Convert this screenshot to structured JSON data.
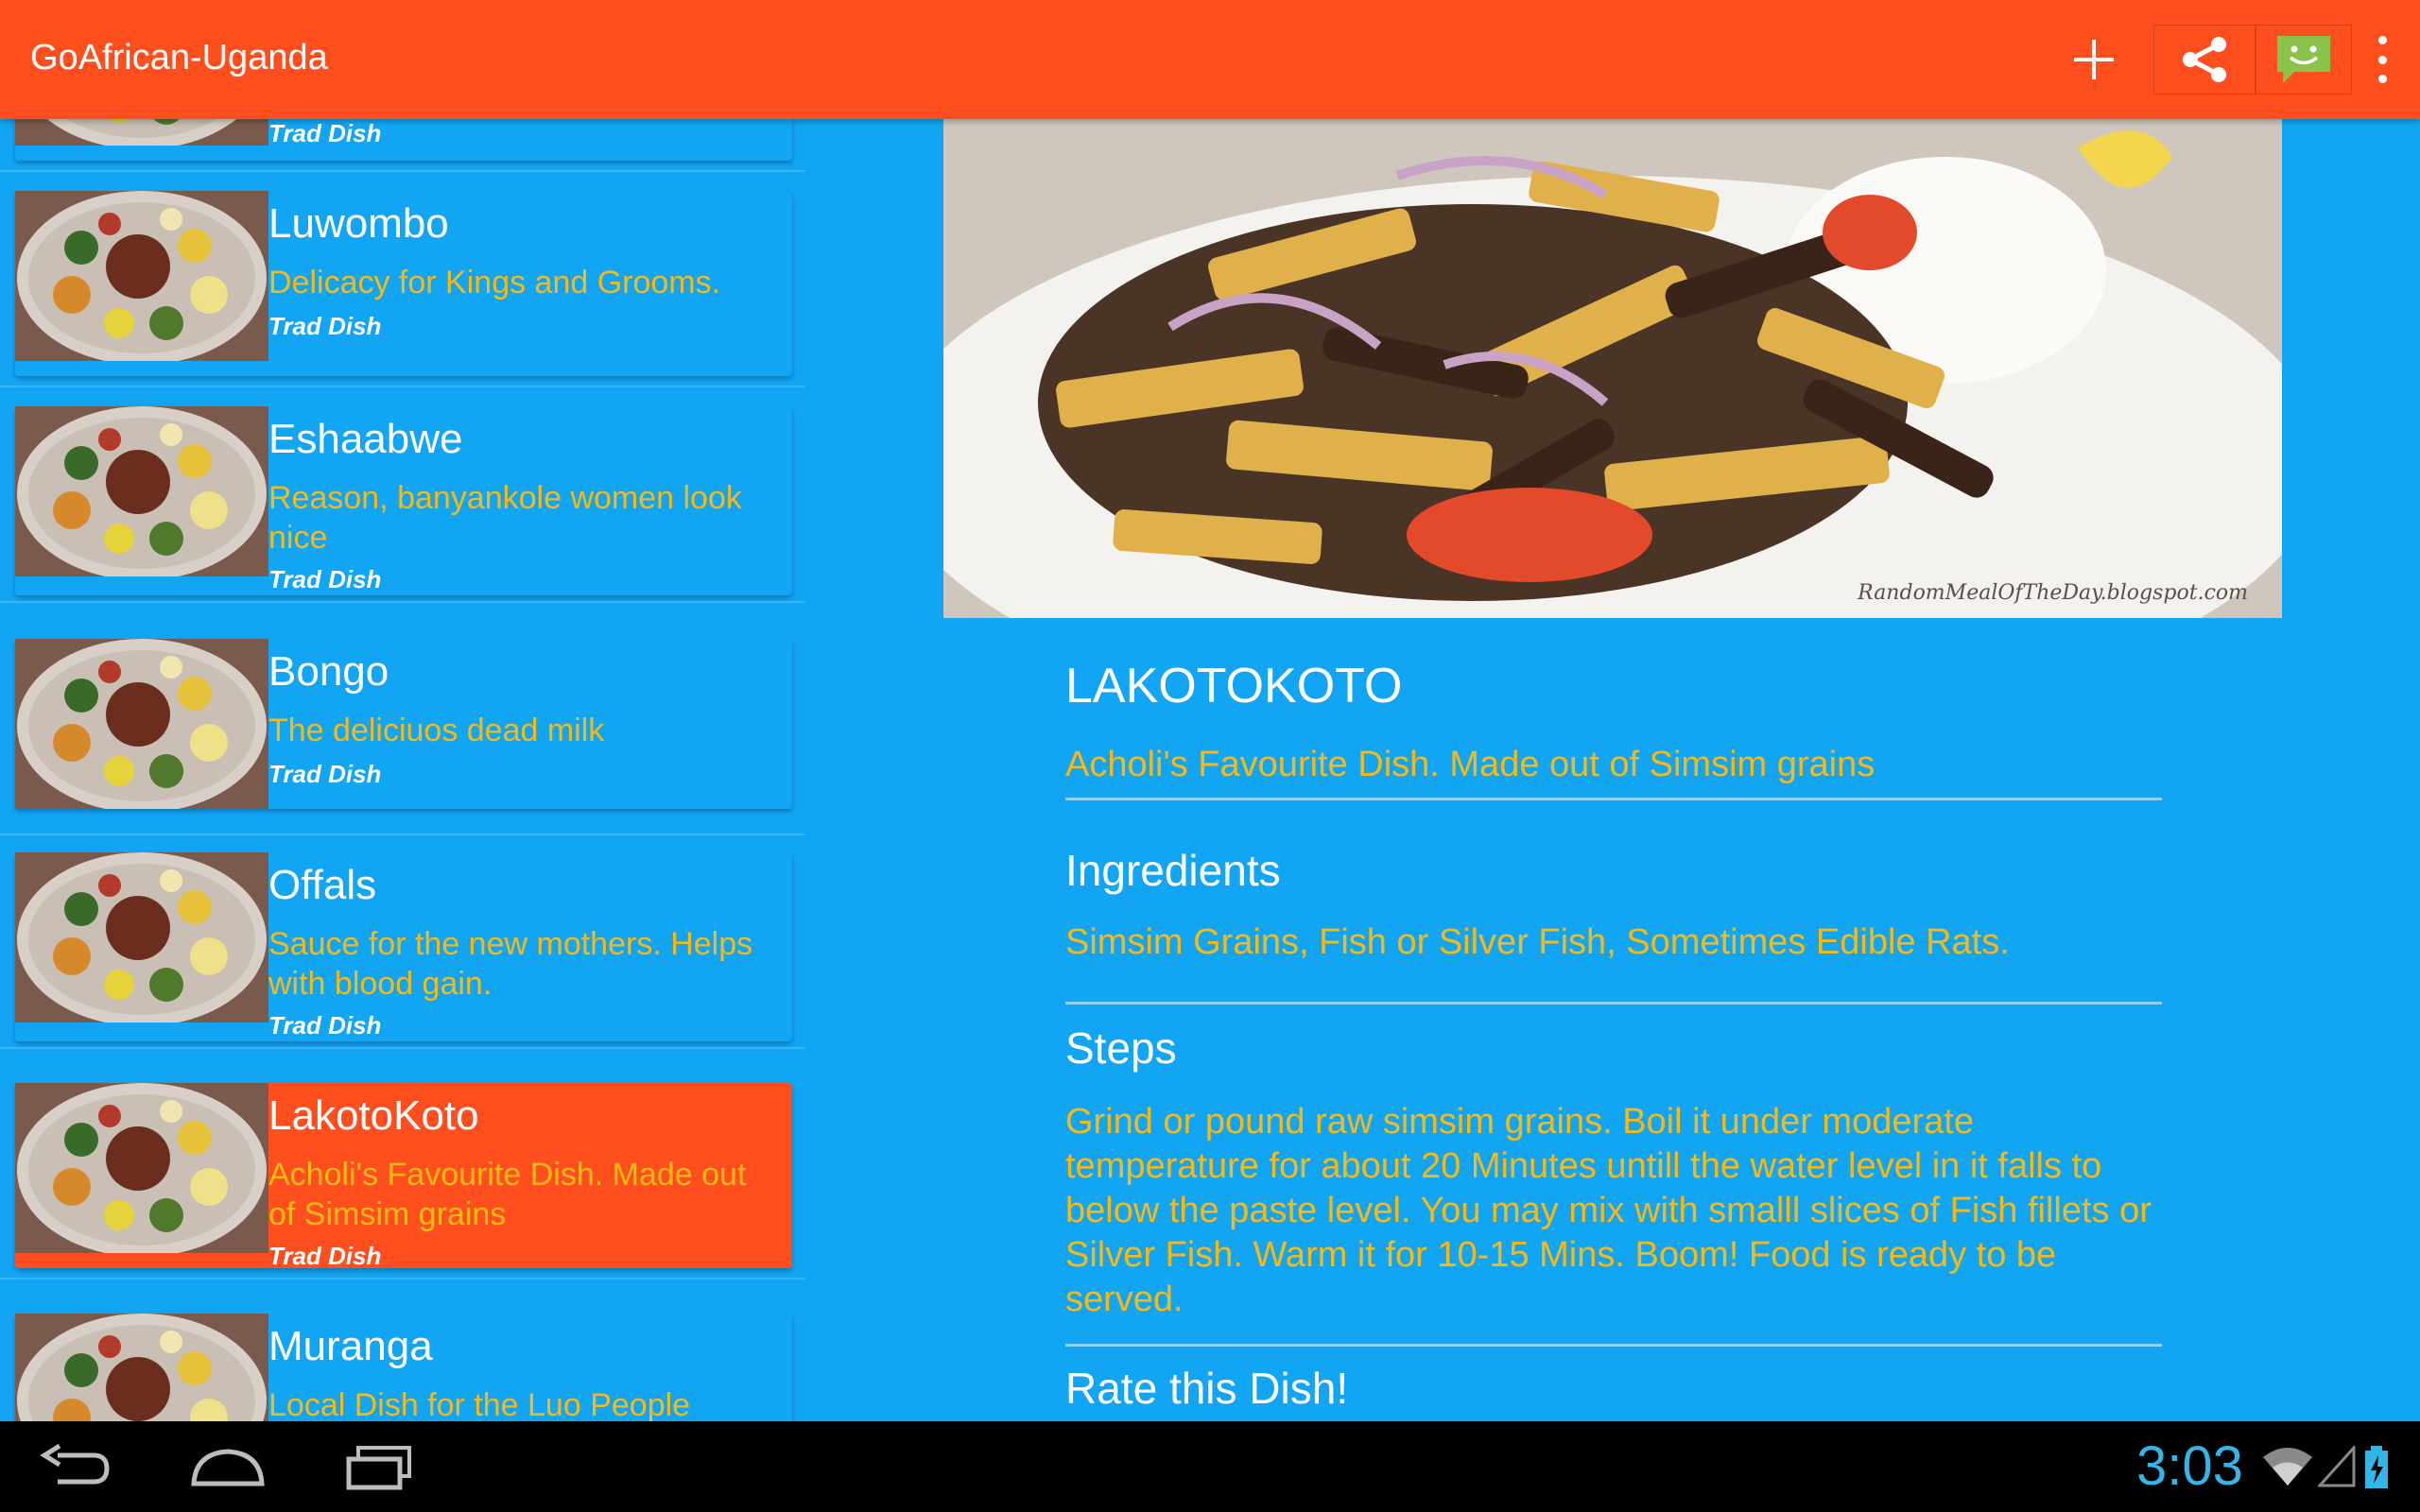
{
  "app": {
    "title": "GoAfrican-Uganda"
  },
  "actionbar": {
    "icons": [
      "add-icon",
      "share-icon",
      "message-icon",
      "overflow-menu-icon"
    ],
    "accent": "#ff4f1e"
  },
  "list": {
    "items": [
      {
        "title": "",
        "desc": "",
        "tag": "Trad Dish",
        "selected": false
      },
      {
        "title": "Luwombo",
        "desc": "Delicacy for Kings and Grooms.",
        "tag": "Trad Dish",
        "selected": false
      },
      {
        "title": "Eshaabwe",
        "desc": "Reason, banyankole women look nice",
        "tag": "Trad Dish",
        "selected": false
      },
      {
        "title": "Bongo",
        "desc": "The deliciuos dead milk",
        "tag": "Trad Dish",
        "selected": false
      },
      {
        "title": "Offals",
        "desc": "Sauce for the new mothers. Helps with blood gain.",
        "tag": "Trad Dish",
        "selected": false
      },
      {
        "title": "LakotoKoto",
        "desc": "Acholi's Favourite Dish. Made out of Simsim grains",
        "tag": "Trad Dish",
        "selected": true
      },
      {
        "title": "Muranga",
        "desc": "Local Dish for the Luo People",
        "tag": "",
        "selected": false
      }
    ]
  },
  "detail": {
    "name": "LAKOTOKOTO",
    "description": "Acholi's Favourite Dish. Made out of Simsim grains",
    "ingredients_title": "Ingredients",
    "ingredients": "Simsim Grains, Fish or Silver Fish, Sometimes Edible Rats.",
    "steps_title": "Steps",
    "steps": "Grind or pound raw simsim grains. Boil it under moderate temperature for about 20 Minutes untill the water level in it falls to below the paste level. You may mix with smalll slices of Fish fillets or Silver Fish. Warm it for 10-15 Mins. Boom! Food is ready to be served.",
    "rate_title": "Rate this Dish!",
    "image_watermark": "RandomMealOfTheDay.blogspot.com"
  },
  "statusbar": {
    "time": "3:03"
  },
  "colors": {
    "background": "#12a5f4",
    "accent": "#ff4f1e",
    "text_yellow": "#f7b916",
    "clock": "#33b5e5"
  }
}
